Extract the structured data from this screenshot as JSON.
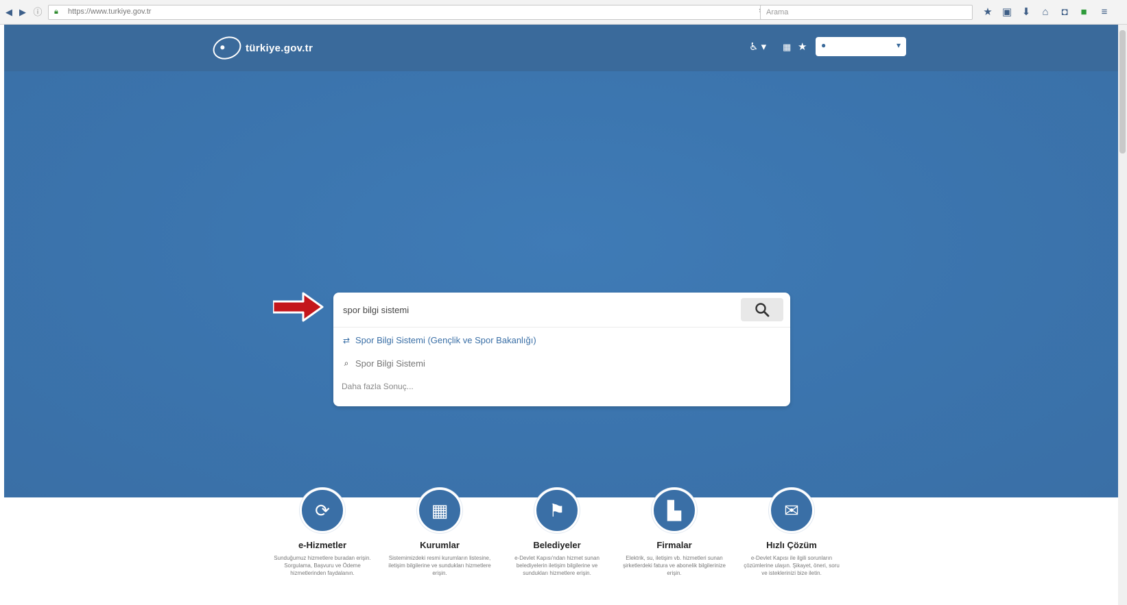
{
  "browser": {
    "url": "https://www.turkiye.gov.tr",
    "search_placeholder": "Arama"
  },
  "header": {
    "logo_text": "türkiye.gov.tr"
  },
  "search": {
    "value": "spor bilgi sistemi",
    "suggestions": [
      {
        "label": "Spor Bilgi Sistemi (Gençlik ve Spor Bakanlığı)",
        "icon": "service-icon"
      },
      {
        "label": "Spor Bilgi Sistemi",
        "icon": "search-icon"
      }
    ],
    "more_results": "Daha fazla Sonuç..."
  },
  "categories": [
    {
      "title": "e-Hizmetler",
      "icon": "refresh-icon",
      "description": "Sunduğumuz hizmetlere buradan erişin. Sorgulama, Başvuru ve Ödeme hizmetlerinden faydalanın."
    },
    {
      "title": "Kurumlar",
      "icon": "building-icon",
      "description": "Sistemimizdeki resmi kurumların listesine, iletişim bilgilerine ve sundukları hizmetlere erişin."
    },
    {
      "title": "Belediyeler",
      "icon": "signpost-icon",
      "description": "e-Devlet Kapısı'ndan hizmet sunan belediyelerin iletişim bilgilerine ve sundukları hizmetlere erişin."
    },
    {
      "title": "Firmalar",
      "icon": "factory-icon",
      "description": "Elektrik, su, iletişim vb. hizmetleri sunan şirketlerdeki fatura ve abonelik bilgilerinize erişin."
    },
    {
      "title": "Hızlı Çözüm",
      "icon": "chat-icon",
      "description": "e-Devlet Kapısı ile ilgili sorunların çözümlerine ulaşın. Şikayet, öneri, soru ve isteklerinizi bize iletin."
    }
  ],
  "colors": {
    "brand_blue": "#3a6fa6",
    "arrow_red": "#c4161c"
  }
}
